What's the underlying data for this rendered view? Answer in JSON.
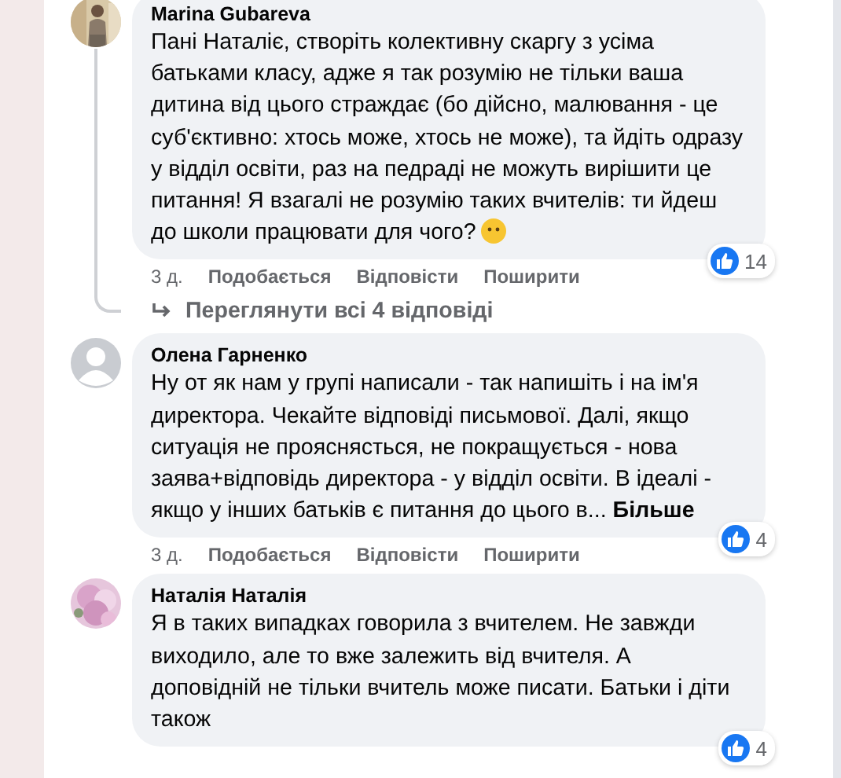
{
  "comments": [
    {
      "author": "Marina Gubareva",
      "text": "Пані Наталіє, створіть колективну скаргу з усіма батьками класу, адже я так розумію не тільки ваша дитина від цього страждає (бо дійсно, малювання - це суб'єктивно: хтось може, хтось не може), та йдіть одразу у відділ освіти, раз на педраді не можуть вирішити це питання! Я взагалі не розумію таких вчителів: ти йдеш до школи працювати для чого?",
      "emoji": true,
      "likes": "14",
      "time": "3 д.",
      "actions": [
        "Подобається",
        "Відповісти",
        "Поширити"
      ],
      "replies_link": "Переглянути всі 4 відповіді"
    },
    {
      "author": "Олена Гарненко",
      "avatar": {
        "kind": "default"
      },
      "text": "Ну от як нам у групі написали - так напишіть і на ім'я директора. Чекайте відповіді письмової. Далі, якщо ситуація не прояснясться, не покращується - нова заява+відповідь директора - у відділ освіти. В ідеалі - якщо у інших батьків є питання до цього в...",
      "more": "Більше",
      "likes": "4",
      "time": "3 д.",
      "actions": [
        "Подобається",
        "Відповісти",
        "Поширити"
      ]
    },
    {
      "author": "Наталія Наталія",
      "text": "Я в таких випадках говорила з вчителем. Не завжди виходило, але то вже залежить від вчителя. А доповідній не тільки вчитель може писати. Батьки і діти також",
      "likes": "4"
    }
  ]
}
